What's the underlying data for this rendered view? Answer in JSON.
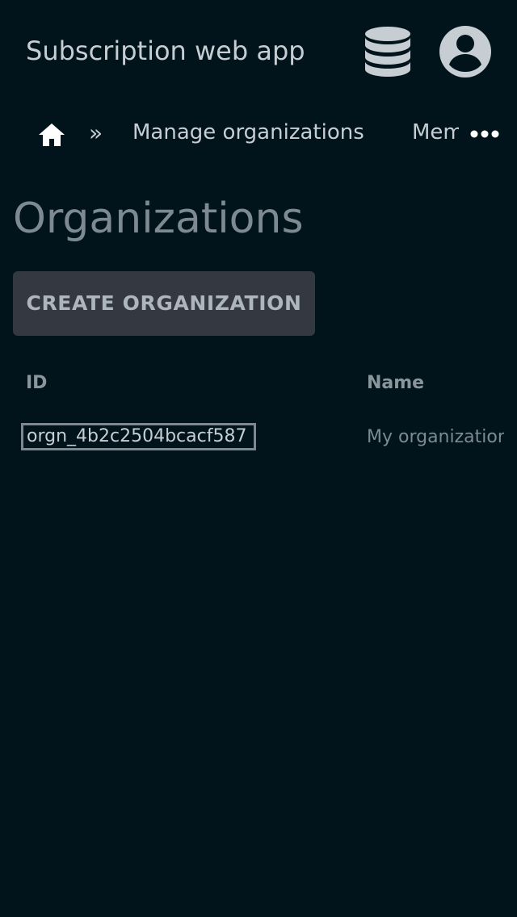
{
  "app": {
    "title": "Subscription web app",
    "icons": [
      "database-icon",
      "account-circle-icon"
    ]
  },
  "breadcrumb": {
    "home_icon": "home-icon",
    "separator": "»",
    "items": [
      {
        "label": "Manage organizations"
      },
      {
        "label": "Members"
      }
    ],
    "more_icon": "more-horizontal-icon"
  },
  "main": {
    "title": "Organizations",
    "create_button_label": "CREATE ORGANIZATION",
    "table": {
      "columns": [
        "ID",
        "Name"
      ],
      "rows": [
        {
          "id": "orgn_4b2c2504bcacf587",
          "name": "My organization"
        }
      ]
    }
  },
  "colors": {
    "background": "#01141c",
    "text": "#c6ced3",
    "muted": "#7d8a91",
    "button_bg": "#343841"
  }
}
